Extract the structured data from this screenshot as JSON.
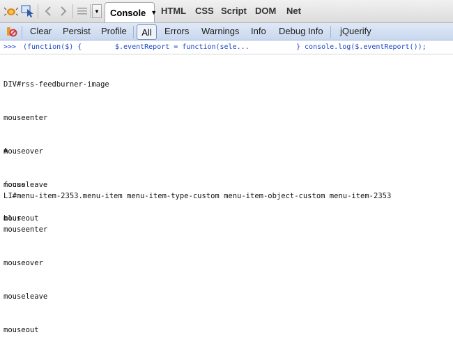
{
  "tabs": {
    "active": "Console",
    "items": [
      "HTML",
      "CSS",
      "Script",
      "DOM",
      "Net"
    ]
  },
  "toolbar": {
    "clear": "Clear",
    "persist": "Persist",
    "profile": "Profile",
    "filters": [
      "All",
      "Errors",
      "Warnings",
      "Info",
      "Debug Info"
    ],
    "jquerify": "jQuerify"
  },
  "command": {
    "prompt": ">>>",
    "part1": "(function($) {",
    "part2": "$.eventReport = function(sele...",
    "part3": "} console.log($.eventReport());"
  },
  "output": {
    "group1": [
      "DIV#rss-feedburner-image",
      "mouseenter",
      "mouseover",
      "mouseleave",
      "mouseout"
    ],
    "group2": [
      "A",
      "focus",
      "blur"
    ],
    "group3": [
      "LI#menu-item-2353.menu-item menu-item-type-custom menu-item-object-custom menu-item-2353",
      "mouseenter",
      "mouseover",
      "mouseleave",
      "mouseout"
    ]
  },
  "colors": {
    "accent": "#1a47c9",
    "toolbar_bg": "#d4e0f2"
  },
  "icons": [
    "firebug-bug-icon",
    "inspect-pointer-icon",
    "back-icon",
    "forward-icon",
    "menu-icon",
    "clear-console-icon"
  ]
}
